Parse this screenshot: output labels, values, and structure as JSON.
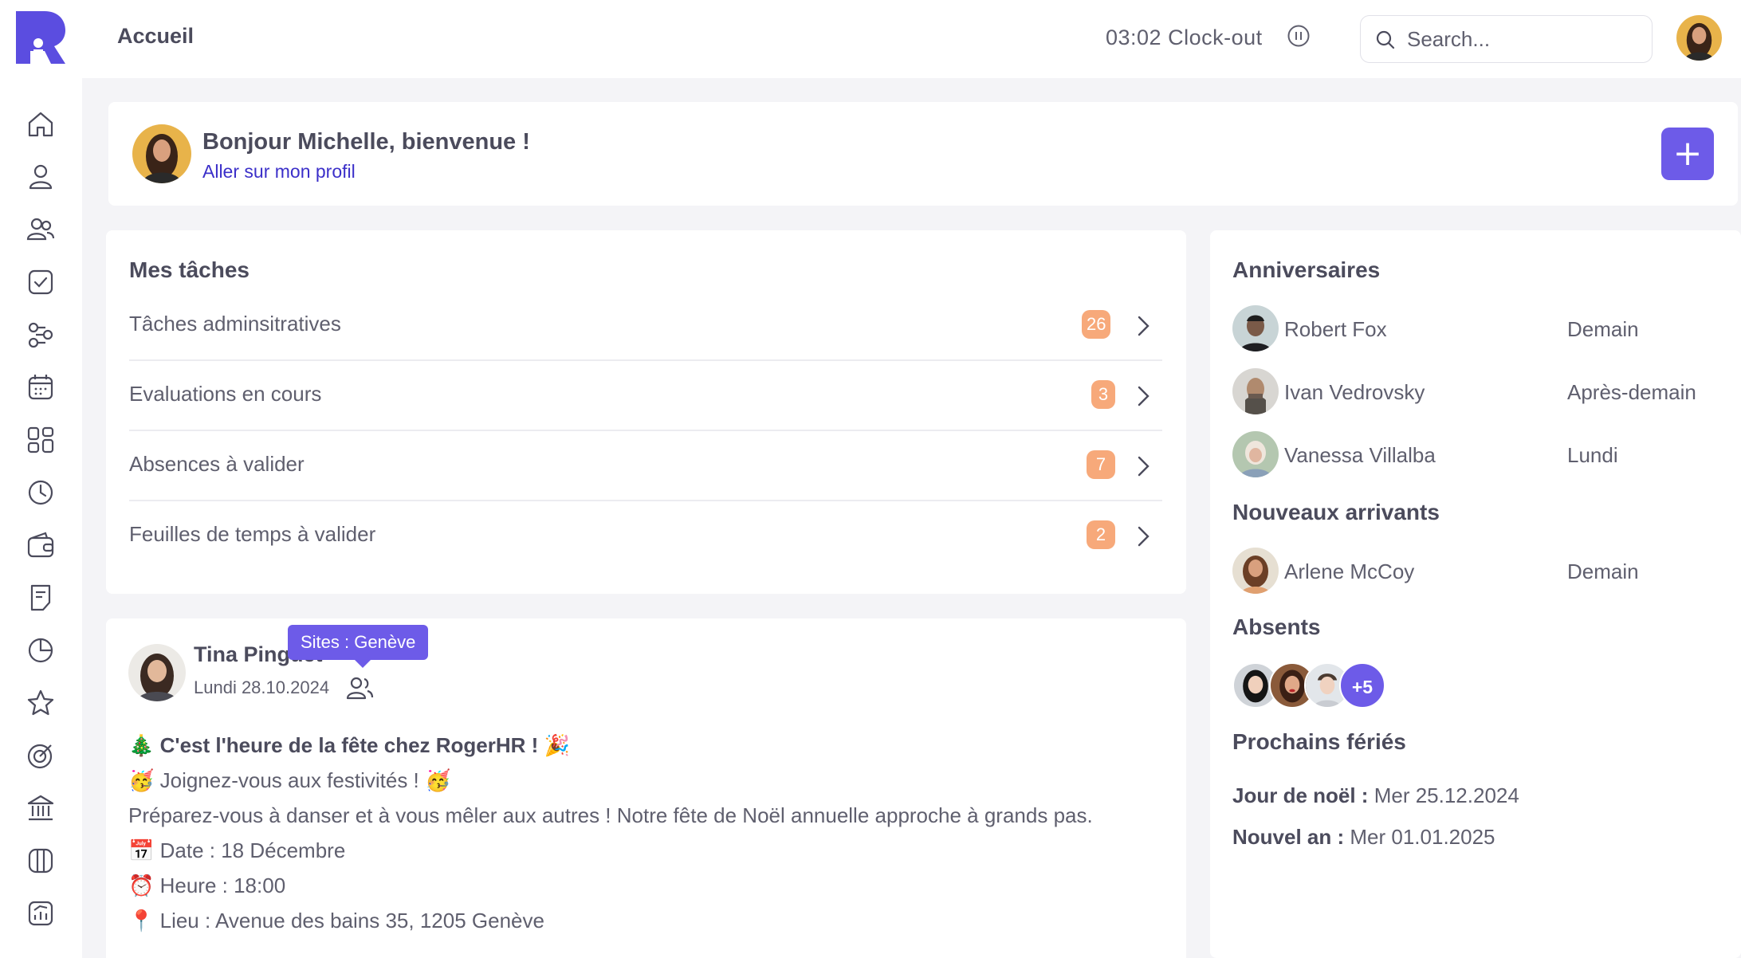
{
  "header": {
    "title": "Accueil",
    "clock": "03:02 Clock-out",
    "search_placeholder": "Search..."
  },
  "sidebar": {
    "items": [
      {
        "icon": "home-icon"
      },
      {
        "icon": "user-icon"
      },
      {
        "icon": "users-icon"
      },
      {
        "icon": "task-check-icon"
      },
      {
        "icon": "workflow-icon"
      },
      {
        "icon": "calendar-icon"
      },
      {
        "icon": "apps-grid-icon"
      },
      {
        "icon": "clock-icon"
      },
      {
        "icon": "wallet-icon"
      },
      {
        "icon": "document-icon"
      },
      {
        "icon": "pie-chart-icon"
      },
      {
        "icon": "star-icon"
      },
      {
        "icon": "target-icon"
      },
      {
        "icon": "bank-icon"
      },
      {
        "icon": "columns-icon"
      },
      {
        "icon": "analytics-icon"
      }
    ]
  },
  "welcome": {
    "greeting": "Bonjour Michelle, bienvenue !",
    "profile_link": "Aller sur mon profil",
    "add_label": "+"
  },
  "tasks": {
    "title": "Mes tâches",
    "items": [
      {
        "label": "Tâches adminsitratives",
        "count": "26"
      },
      {
        "label": "Evaluations en cours",
        "count": "3"
      },
      {
        "label": "Absences à valider",
        "count": "7"
      },
      {
        "label": "Feuilles de temps à valider",
        "count": "2"
      }
    ]
  },
  "post": {
    "author": "Tina Pinguet",
    "date": "Lundi 28.10.2024",
    "tooltip": "Sites : Genève",
    "headline": "C'est l'heure de la fête chez RogerHR !",
    "line1": "Joignez-vous aux festivités !",
    "line2": "Préparez-vous à danser et à vous mêler aux autres ! Notre fête de Noël annuelle approche à grands pas.",
    "line3": "Date : 18 Décembre",
    "line4": "Heure : 18:00",
    "line5": "Lieu : Avenue des bains 35, 1205 Genève",
    "emoji": {
      "tree": "🎄",
      "party": "🎉",
      "face": "🥳",
      "cal": "📅",
      "alarm": "⏰",
      "pin": "📍"
    }
  },
  "birthdays": {
    "title": "Anniversaires",
    "items": [
      {
        "name": "Robert Fox",
        "when": "Demain"
      },
      {
        "name": "Ivan Vedrovsky",
        "when": "Après-demain"
      },
      {
        "name": "Vanessa Villalba",
        "when": "Lundi"
      }
    ]
  },
  "newcomers": {
    "title": "Nouveaux arrivants",
    "items": [
      {
        "name": "Arlene McCoy",
        "when": "Demain"
      }
    ]
  },
  "absents": {
    "title": "Absents",
    "more": "+5"
  },
  "holidays": {
    "title": "Prochains fériés",
    "items": [
      {
        "label": "Jour de noël :",
        "date": "Mer 25.12.2024"
      },
      {
        "label": "Nouvel an :",
        "date": "Mer 01.01.2025"
      }
    ]
  },
  "colors": {
    "accent": "#6d5be8",
    "link": "#3b2fc9",
    "badge": "#f7a97a",
    "background": "#f4f4f7"
  }
}
